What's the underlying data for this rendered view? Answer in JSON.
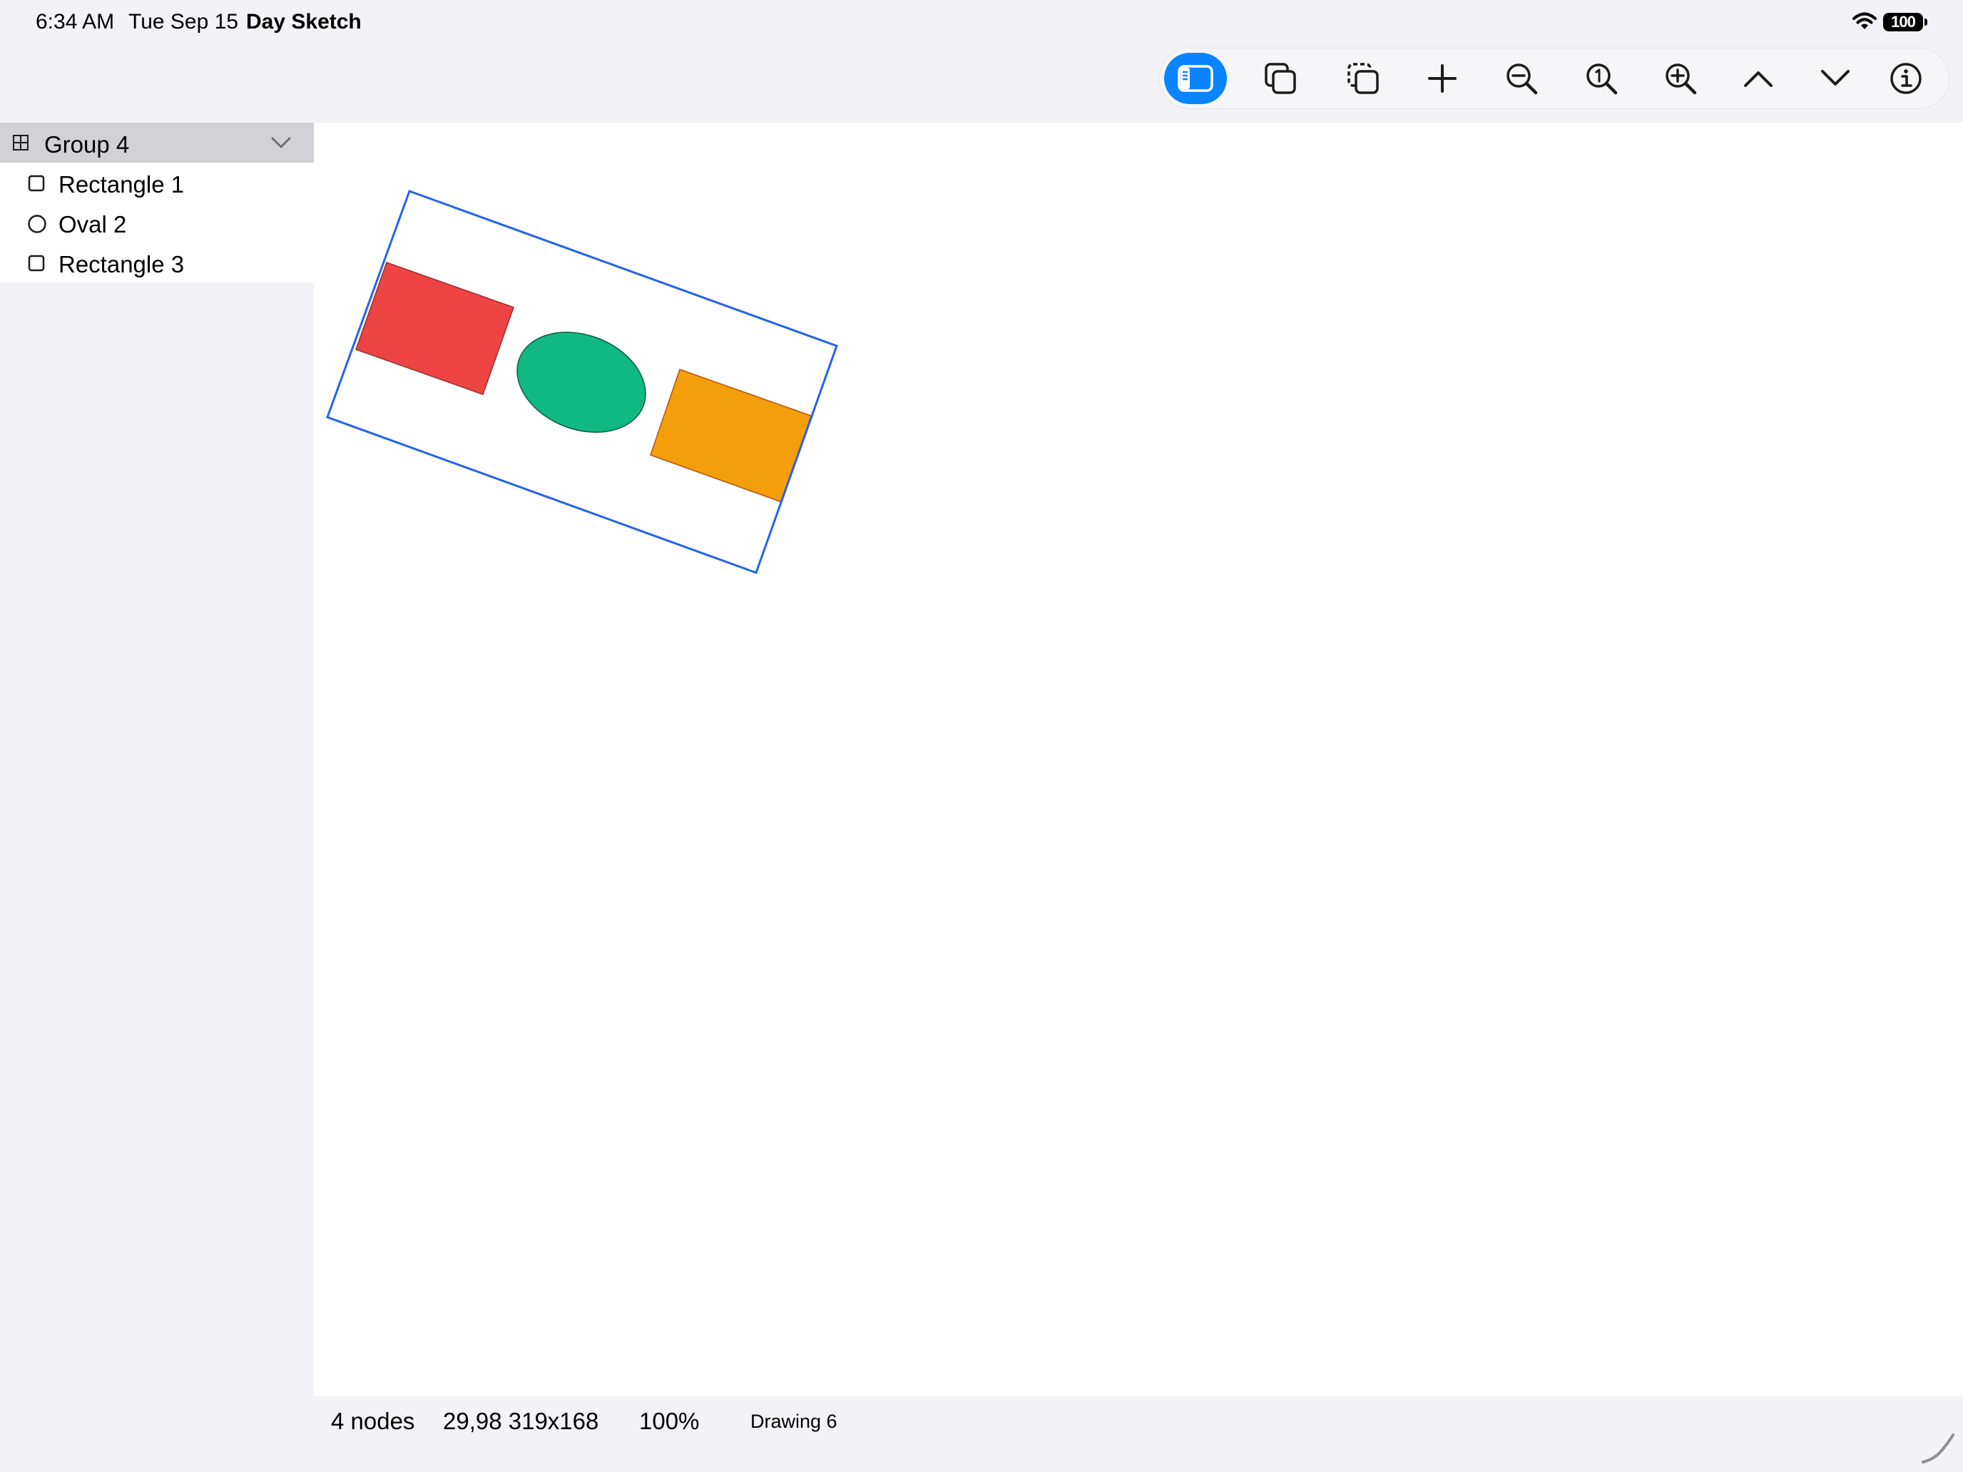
{
  "status_bar": {
    "time": "6:34 AM",
    "date": "Tue Sep 15",
    "app_name": "Day Sketch",
    "battery_level": "100",
    "icons": [
      "wifi-icon",
      "battery-icon"
    ]
  },
  "toolbar": {
    "buttons": [
      {
        "name": "toggle-sidebar",
        "icon": "sidebar-icon",
        "active": true
      },
      {
        "name": "duplicate",
        "icon": "duplicate-icon"
      },
      {
        "name": "copy-selection",
        "icon": "copy-dashed-icon"
      },
      {
        "name": "add",
        "icon": "plus-icon"
      },
      {
        "name": "zoom-out",
        "icon": "zoom-out-icon"
      },
      {
        "name": "actual-size",
        "icon": "zoom-actual-icon"
      },
      {
        "name": "zoom-in",
        "icon": "zoom-in-icon"
      },
      {
        "name": "move-up",
        "icon": "chevron-up-icon"
      },
      {
        "name": "move-down",
        "icon": "chevron-down-icon"
      },
      {
        "name": "info",
        "icon": "info-icon"
      }
    ],
    "accent_color": "#0a84ff"
  },
  "outline": {
    "group": {
      "label": "Group 4",
      "icon": "group-icon",
      "expanded": true,
      "selected": true
    },
    "children": [
      {
        "label": "Rectangle 1",
        "icon": "rectangle-icon"
      },
      {
        "label": "Oval 2",
        "icon": "oval-icon"
      },
      {
        "label": "Rectangle 3",
        "icon": "rectangle-icon"
      }
    ]
  },
  "canvas": {
    "selection_color": "#2563eb",
    "shapes": [
      {
        "name": "Rectangle 1",
        "type": "rectangle",
        "fill": "#ef4444"
      },
      {
        "name": "Oval 2",
        "type": "oval",
        "fill": "#10b981"
      },
      {
        "name": "Rectangle 3",
        "type": "rectangle",
        "fill": "#f59e0b"
      }
    ]
  },
  "footer": {
    "node_count": "4 nodes",
    "frame": "29,98 319x168",
    "zoom": "100%",
    "document_name": "Drawing 6"
  }
}
